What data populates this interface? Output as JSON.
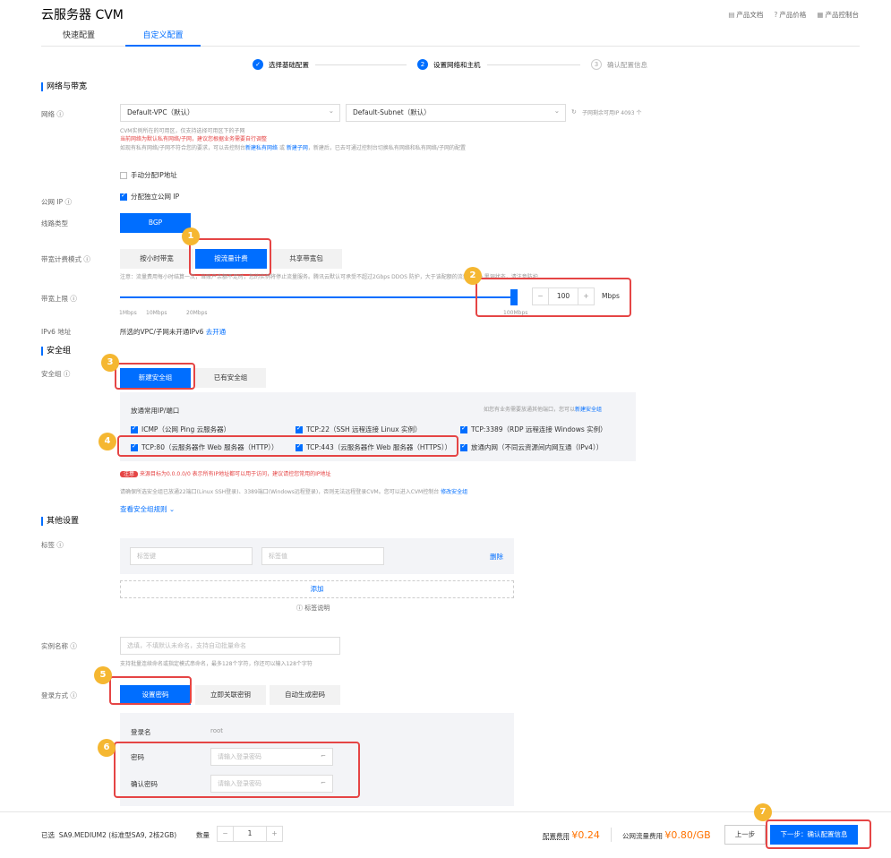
{
  "title": "云服务器 CVM",
  "toplinks": [
    "产品文档",
    "产品价格",
    "产品控制台"
  ],
  "tabs": [
    "快速配置",
    "自定义配置"
  ],
  "steps": [
    "选择基础配置",
    "设置网络和主机",
    "确认配置信息"
  ],
  "sections": {
    "network": "网络与带宽",
    "security": "安全组",
    "other": "其他设置"
  },
  "network": {
    "label": "网络",
    "vpc": "Default-VPC（默认）",
    "subnet": "Default-Subnet（默认）",
    "ip_note": "子网剩余可用IP 4093 个",
    "note1": "CVM实例所在的可用区，仅支持选择可用区下的子网",
    "note2": "当前网络为默认私有网络/子网，建议您根据业务需要自行调整",
    "note3": "如现有私有网络/子网不符合您的要求，可以去控制台",
    "link1": "新建私有网络",
    "or": "或",
    "link2": "新建子网",
    "note4": "，新建后，已去可通过控制台切换私有网络和私有网络/子网的配置",
    "manual_ip": "手动分配IP地址"
  },
  "public_ip": {
    "label": "公网 IP",
    "option": "分配独立公网 IP"
  },
  "line": {
    "label": "线路类型",
    "value": "BGP"
  },
  "billing": {
    "label": "带宽计费模式",
    "options": [
      "按小时带宽",
      "按流量计费",
      "共享带宽包"
    ],
    "note": "注意：流量费用每小时结算一次，当账户余额不足时，您的实例将停止流量服务。腾讯云默认可承受不超过2Gbps DDOS 防护，大于该配额的流量会进入黑洞状态，请注意防护"
  },
  "bandwidth": {
    "label": "带宽上限",
    "value": "100",
    "unit": "Mbps",
    "ticks": [
      "1Mbps",
      "10Mbps",
      "20Mbps",
      "100Mbps"
    ]
  },
  "ipv6": {
    "label": "IPv6 地址",
    "text": "所选的VPC/子网未开通IPv6",
    "link": "去开通"
  },
  "sg": {
    "label": "安全组",
    "new": "新建安全组",
    "existing": "已有安全组",
    "panel_title": "放通常用IP/端口",
    "panel_hint": "如您有业务需要放通其他端口，您可以",
    "panel_link": "新建安全组",
    "ports": [
      "ICMP（公网 Ping 云服务器）",
      "TCP:22（SSH 远程连接 Linux 实例）",
      "TCP:3389（RDP 远程连接 Windows 实例）",
      "TCP:80（云服务器作 Web 服务器（HTTP））",
      "TCP:443（云服务器作 Web 服务器（HTTPS））",
      "放通内网（不同云资源间内网互通（IPv4））"
    ],
    "warn_tag": "注意",
    "warn": "来源目标为0.0.0.0/0 表示所有IP地址都可以用于访问，建议请控您常用的IP地址",
    "note": "请确保所选安全组已放通22端口(Linux SSH登录)、3389端口(Windows远程登录)，否则无法远程登录CVM。您可以进入CVM控制台",
    "note_link": "修改安全组",
    "view": "查看安全组规则"
  },
  "tags": {
    "label": "标签",
    "key_ph": "标签键",
    "val_ph": "标签值",
    "delete": "删除",
    "add": "添加",
    "help": "标签说明"
  },
  "instance": {
    "label": "实例名称",
    "placeholder": "选填，不填默认未命名，支持自动批量命名",
    "note": "支持批量连续命名或指定模式串命名，最多128个字符，你还可以输入128个字符"
  },
  "login": {
    "label": "登录方式",
    "options": [
      "设置密码",
      "立即关联密钥",
      "自动生成密码"
    ],
    "user_label": "登录名",
    "user": "root",
    "pwd_label": "密码",
    "pwd_ph": "请输入登录密码",
    "confirm_label": "确认密码",
    "confirm_ph": "请输入登录密码"
  },
  "footer": {
    "selected_label": "已选",
    "selected": "SA9.MEDIUM2 (标准型SA9, 2核2GB)",
    "qty_label": "数量",
    "qty": "1",
    "fee_label": "配置费用",
    "fee": "¥0.24",
    "traffic_label": "公网流量费用",
    "traffic": "¥0.80/GB",
    "prev": "上一步",
    "next": "下一步：确认配置信息"
  },
  "badges": [
    "1",
    "2",
    "3",
    "4",
    "5",
    "6",
    "7"
  ]
}
